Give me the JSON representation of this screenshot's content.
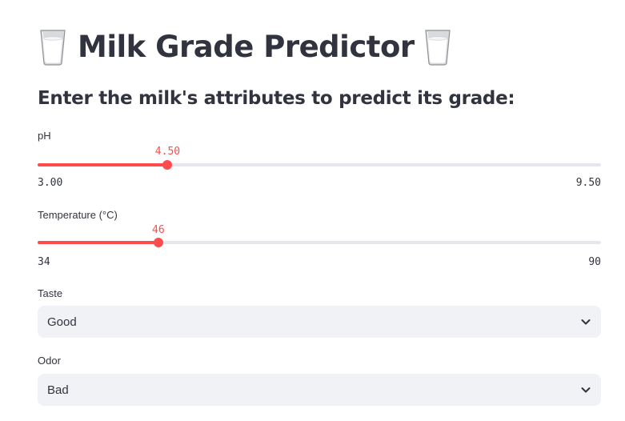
{
  "header": {
    "title": "Milk Grade Predictor",
    "left_icon": "milk-glass-icon",
    "right_icon": "milk-glass-icon"
  },
  "subtitle": "Enter the milk's attributes to predict its grade:",
  "sliders": {
    "ph": {
      "label": "pH",
      "min": 3.0,
      "max": 9.5,
      "value": 4.5,
      "min_text": "3.00",
      "max_text": "9.50",
      "value_text": "4.50"
    },
    "temperature": {
      "label": "Temperature (°C)",
      "min": 34,
      "max": 90,
      "value": 46,
      "min_text": "34",
      "max_text": "90",
      "value_text": "46"
    }
  },
  "selects": {
    "taste": {
      "label": "Taste",
      "value": "Good"
    },
    "odor": {
      "label": "Odor",
      "value": "Bad"
    }
  },
  "colors": {
    "accent": "#ff4b4b",
    "track": "#e5e7ec",
    "select_bg": "#f0f2f6",
    "text": "#31333f"
  }
}
